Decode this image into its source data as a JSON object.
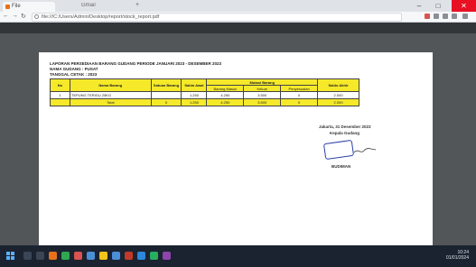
{
  "browser": {
    "active_tab_title": "File",
    "inactive_tab_title": "Gmail",
    "new_tab_label": "+",
    "url": "file:///C:/Users/Admin/Desktop/report/stock_report.pdf",
    "minimize_label": "–",
    "maximize_label": "□",
    "close_label": "✕"
  },
  "document": {
    "header_lines": [
      "LAPORAN PERSEDIAAN BARANG GUDANG PERIODE JANUARI 2023 - DESEMBER 2023",
      "NAMA GUDANG : PUSAT",
      "TANGGAL CETAK : 2023"
    ],
    "table": {
      "headers": {
        "no": "No",
        "name": "Nama Barang",
        "unit": "Satuan Barang",
        "stock": "Saldo Awal",
        "movement_group": "Mutasi Barang",
        "masuk": "Barang Masuk",
        "keluar": "Keluar",
        "penyesuaian": "Penyesuaian",
        "final": "Saldo Akhir"
      },
      "rows": [
        {
          "no": "1",
          "name": "TEPUNG TERIGU 25KG",
          "unit": "",
          "stock": "1.250",
          "masuk": "4.250",
          "keluar": "3.500",
          "penyesuaian": "0",
          "final": "2.000"
        }
      ],
      "total": {
        "label": "Total",
        "unit": "0",
        "stock": "1.250",
        "masuk": "4.250",
        "keluar": "3.500",
        "penyesuaian": "0",
        "final": "2.000"
      }
    },
    "signature": {
      "city_date": "Jakarta, 31 Desember 2023",
      "role": "Kepala Gudang",
      "stamp_text": "PT. MAKMUR JAYA",
      "name": "BUDIMAN"
    }
  },
  "taskbar": {
    "time": "10:24",
    "date": "01/01/2024"
  },
  "colors": {
    "table_header": "#f5e92a",
    "viewer_bg": "#525659",
    "taskbar_bg": "#1b2330",
    "stamp": "#2b3ea6"
  }
}
